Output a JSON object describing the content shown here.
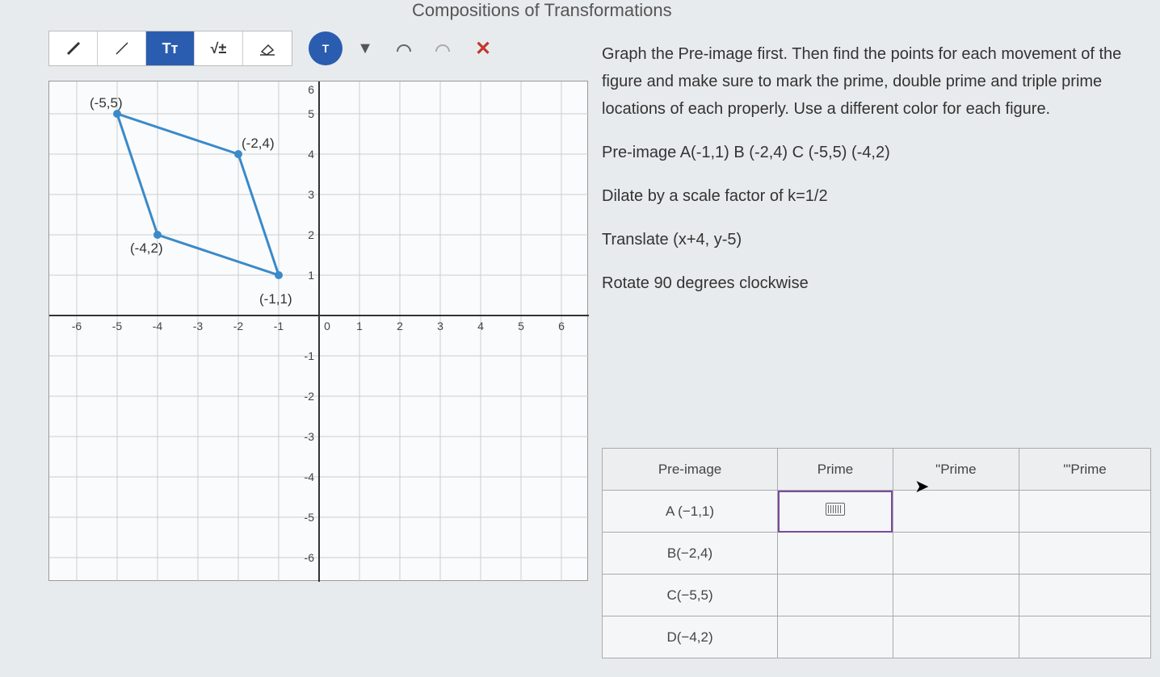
{
  "title": "Compositions of Transformations",
  "toolbar": {
    "pen_thick": "✏",
    "pen_thin": "/",
    "text": "Tᴛ",
    "math": "√±",
    "eraser": "⌫",
    "color_label": "T",
    "dropdown": "▼",
    "undo": "↶",
    "redo": "↷",
    "close": "✕"
  },
  "instructions": {
    "p1": "Graph the Pre-image first. Then find the points for each movement of the figure and make sure to mark the prime, double prime and triple prime locations of each properly. Use a different color for each figure.",
    "p2": "Pre-image A(-1,1)  B (-2,4)  C (-5,5)  (-4,2)",
    "p3": "Dilate by a scale factor of k=1/2",
    "p4": "Translate (x+4, y-5)",
    "p5": "Rotate 90 degrees clockwise"
  },
  "table": {
    "headers": [
      "Pre-image",
      "Prime",
      "\"Prime",
      "'\"Prime"
    ],
    "rows": [
      {
        "pre": "A (−1,1)",
        "p1": "",
        "p2": "",
        "p3": ""
      },
      {
        "pre": "B(−2,4)",
        "p1": "",
        "p2": "",
        "p3": ""
      },
      {
        "pre": "C(−5,5)",
        "p1": "",
        "p2": "",
        "p3": ""
      },
      {
        "pre": "D(−4,2)",
        "p1": "",
        "p2": "",
        "p3": ""
      }
    ]
  },
  "chart_data": {
    "type": "scatter",
    "title": "",
    "xlabel": "",
    "ylabel": "",
    "xlim": [
      -6,
      6
    ],
    "ylim": [
      -6,
      6
    ],
    "grid": true,
    "x_ticks": [
      -6,
      -5,
      -4,
      -3,
      -2,
      -1,
      0,
      1,
      2,
      3,
      4,
      5,
      6
    ],
    "y_ticks": [
      -6,
      -5,
      -4,
      -3,
      -2,
      -1,
      0,
      1,
      2,
      3,
      4,
      5,
      6
    ],
    "series": [
      {
        "name": "Pre-image polygon",
        "type": "polygon",
        "color": "#3a8ac9",
        "points": [
          {
            "x": -1,
            "y": 1,
            "label": "(-1,1)"
          },
          {
            "x": -2,
            "y": 4,
            "label": "(-2,4)"
          },
          {
            "x": -5,
            "y": 5,
            "label": "(-5,5)"
          },
          {
            "x": -4,
            "y": 2,
            "label": "(-4,2)"
          }
        ]
      }
    ]
  }
}
